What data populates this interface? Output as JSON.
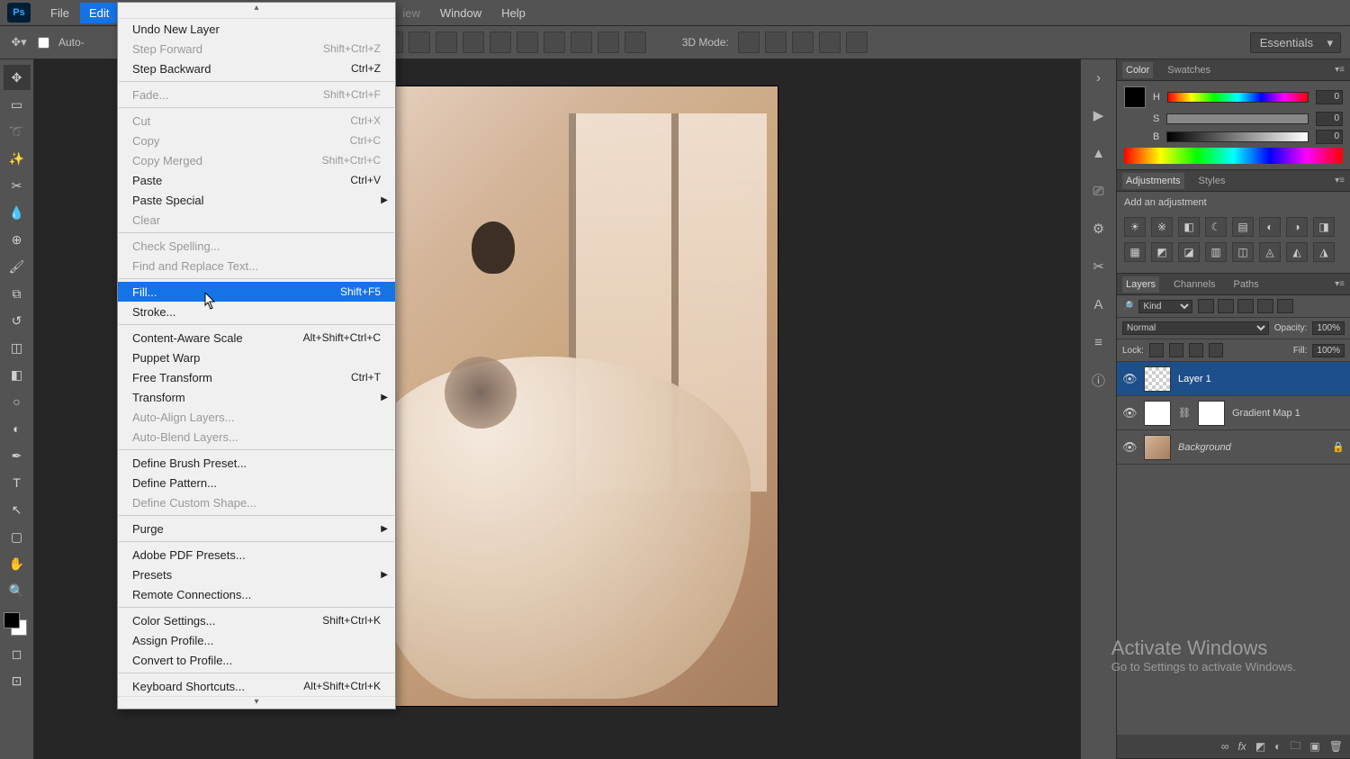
{
  "menubar": {
    "items": [
      "File",
      "Edit",
      "View",
      "Window",
      "Help"
    ],
    "active": "Edit",
    "hidden_label": "iew"
  },
  "optionsbar": {
    "auto_select": "Auto-",
    "mode_label": "3D Mode:",
    "workspace": "Essentials"
  },
  "left_tools": [
    "move",
    "marquee",
    "lasso",
    "wand",
    "crop",
    "eyedropper",
    "heal",
    "brush",
    "stamp",
    "history-brush",
    "eraser",
    "gradient",
    "blur",
    "dodge",
    "pen",
    "type",
    "path",
    "shape",
    "hand",
    "zoom"
  ],
  "dropdown": {
    "groups": [
      [
        {
          "label": "Undo New Layer",
          "shortcut": "",
          "disabled": false
        },
        {
          "label": "Step Forward",
          "shortcut": "Shift+Ctrl+Z",
          "disabled": true
        },
        {
          "label": "Step Backward",
          "shortcut": "Ctrl+Z",
          "disabled": false
        }
      ],
      [
        {
          "label": "Fade...",
          "shortcut": "Shift+Ctrl+F",
          "disabled": true
        }
      ],
      [
        {
          "label": "Cut",
          "shortcut": "Ctrl+X",
          "disabled": true
        },
        {
          "label": "Copy",
          "shortcut": "Ctrl+C",
          "disabled": true
        },
        {
          "label": "Copy Merged",
          "shortcut": "Shift+Ctrl+C",
          "disabled": true
        },
        {
          "label": "Paste",
          "shortcut": "Ctrl+V",
          "disabled": false
        },
        {
          "label": "Paste Special",
          "shortcut": "",
          "disabled": false,
          "submenu": true
        },
        {
          "label": "Clear",
          "shortcut": "",
          "disabled": true
        }
      ],
      [
        {
          "label": "Check Spelling...",
          "shortcut": "",
          "disabled": true
        },
        {
          "label": "Find and Replace Text...",
          "shortcut": "",
          "disabled": true
        }
      ],
      [
        {
          "label": "Fill...",
          "shortcut": "Shift+F5",
          "disabled": false,
          "highlight": true
        },
        {
          "label": "Stroke...",
          "shortcut": "",
          "disabled": false
        }
      ],
      [
        {
          "label": "Content-Aware Scale",
          "shortcut": "Alt+Shift+Ctrl+C",
          "disabled": false
        },
        {
          "label": "Puppet Warp",
          "shortcut": "",
          "disabled": false
        },
        {
          "label": "Free Transform",
          "shortcut": "Ctrl+T",
          "disabled": false
        },
        {
          "label": "Transform",
          "shortcut": "",
          "disabled": false,
          "submenu": true
        },
        {
          "label": "Auto-Align Layers...",
          "shortcut": "",
          "disabled": true
        },
        {
          "label": "Auto-Blend Layers...",
          "shortcut": "",
          "disabled": true
        }
      ],
      [
        {
          "label": "Define Brush Preset...",
          "shortcut": "",
          "disabled": false
        },
        {
          "label": "Define Pattern...",
          "shortcut": "",
          "disabled": false
        },
        {
          "label": "Define Custom Shape...",
          "shortcut": "",
          "disabled": true
        }
      ],
      [
        {
          "label": "Purge",
          "shortcut": "",
          "disabled": false,
          "submenu": true
        }
      ],
      [
        {
          "label": "Adobe PDF Presets...",
          "shortcut": "",
          "disabled": false
        },
        {
          "label": "Presets",
          "shortcut": "",
          "disabled": false,
          "submenu": true
        },
        {
          "label": "Remote Connections...",
          "shortcut": "",
          "disabled": false
        }
      ],
      [
        {
          "label": "Color Settings...",
          "shortcut": "Shift+Ctrl+K",
          "disabled": false
        },
        {
          "label": "Assign Profile...",
          "shortcut": "",
          "disabled": false
        },
        {
          "label": "Convert to Profile...",
          "shortcut": "",
          "disabled": false
        }
      ],
      [
        {
          "label": "Keyboard Shortcuts...",
          "shortcut": "Alt+Shift+Ctrl+K",
          "disabled": false
        }
      ]
    ]
  },
  "color_panel": {
    "tabs": [
      "Color",
      "Swatches"
    ],
    "label_h": "H",
    "label_s": "S",
    "label_b": "B",
    "h": "0",
    "s": "0",
    "b": "0"
  },
  "adjustments_panel": {
    "tabs": [
      "Adjustments",
      "Styles"
    ],
    "heading": "Add an adjustment",
    "icons": [
      "☀",
      "※",
      "◧",
      "☾",
      "▤",
      "◐",
      "◑",
      "◨",
      "▦",
      "◩",
      "◪",
      "▥",
      "◫",
      "◬",
      "◭",
      "◮"
    ]
  },
  "layers_panel": {
    "tabs": [
      "Layers",
      "Channels",
      "Paths"
    ],
    "kind": "Kind",
    "blend": "Normal",
    "opacity_label": "Opacity:",
    "opacity_val": "100%",
    "lock_label": "Lock:",
    "fill_label": "Fill:",
    "fill_val": "100%",
    "layers": [
      {
        "name": "Layer 1",
        "thumb": "checker",
        "selected": true
      },
      {
        "name": "Gradient Map 1",
        "thumb": "white",
        "mask": true
      },
      {
        "name": "Background",
        "thumb": "img",
        "locked": true,
        "italic": true
      }
    ]
  },
  "watermark": {
    "l1": "Activate Windows",
    "l2": "Go to Settings to activate Windows."
  },
  "right_strip_icons": [
    "›",
    "▶",
    "▲",
    "⎚",
    "⚙",
    "✂",
    "A",
    "≡",
    "ⓘ"
  ]
}
